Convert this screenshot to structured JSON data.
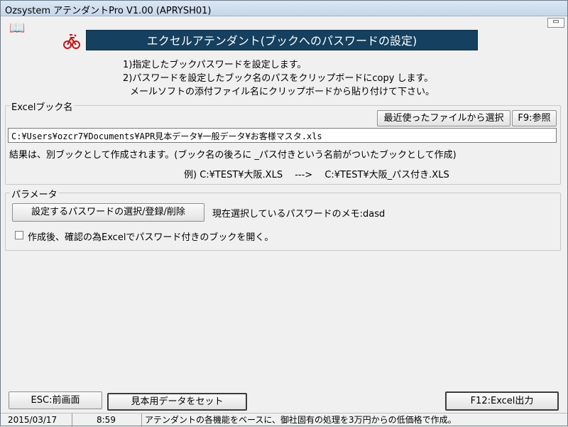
{
  "window": {
    "title": "Ozsystem アテンダントPro V1.00 (APRYSH01)",
    "restore_button": "▭"
  },
  "banner": {
    "title": "エクセルアテンダント(ブックへのパスワードの設定)"
  },
  "notes": [
    "1)指定したブックパスワードを設定します。",
    "2)パスワードを設定したブック名のパスをクリップボードにcopy します。",
    "メールソフトの添付ファイル名にクリップボードから貼り付けて下さい。"
  ],
  "excel_book": {
    "legend": "Excelブック名",
    "recent_button": "最近使ったファイルから選択",
    "browse_button": "F9:参照",
    "path_value": "C:¥Users¥ozcr7¥Documents¥APR見本データ¥一般データ¥お客様マスタ.xls",
    "result_text": "結果は、別ブックとして作成されます。(ブック名の後ろに _パス付きという名前がついたブックとして作成)",
    "example_text": "例) C:¥TEST¥大阪.XLS　 --->　 C:¥TEST¥大阪_パス付き.XLS"
  },
  "parameters": {
    "legend": "パラメータ",
    "password_button": "設定するパスワードの選択/登録/削除",
    "current_password_label": "現在選択しているパスワードのメモ:dasd",
    "open_excel_checkbox_label": "作成後、確認の為Excelでパスワード付きのブックを開く。",
    "open_excel_checked": false
  },
  "footer_buttons": {
    "back": "ESC:前画面",
    "sample_data": "見本用データをセット",
    "export": "F12:Excel出力"
  },
  "status_bar": {
    "date": "2015/03/17",
    "time": "8:59",
    "message": "アテンダントの各機能をベースに、御社固有の処理を3万円からの低価格で作成。"
  },
  "colors": {
    "banner_bg": "#15405f",
    "titlebar_bg": "#c6d6ea"
  }
}
